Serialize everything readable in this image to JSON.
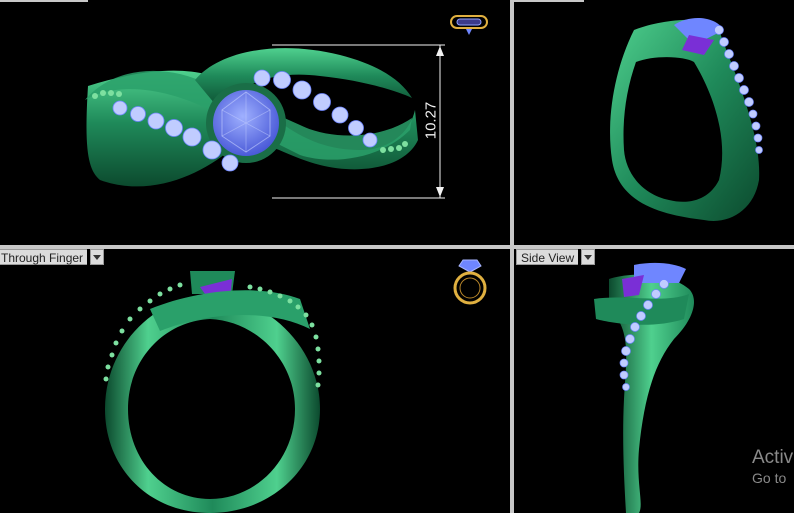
{
  "viewports": {
    "top": {
      "dimension_value": "10.27"
    },
    "perspective": {},
    "front": {
      "label": "Through Finger"
    },
    "side": {
      "label": "Side View"
    }
  },
  "colors": {
    "metal": "#1f8a5a",
    "metal_light": "#4fd08e",
    "metal_dark": "#0c4a2e",
    "center_stone": "#6f86ff",
    "side_stone": "#b9c8ff",
    "accent_stone": "#7a2fd6",
    "dimension_line": "#f2f2f2",
    "nav_icon": "#e0b040"
  },
  "icons": {
    "top_nav": "ring-top-view-icon",
    "front_nav": "ring-front-view-icon"
  },
  "watermark": {
    "line1": "Activ",
    "line2": "Go to"
  }
}
